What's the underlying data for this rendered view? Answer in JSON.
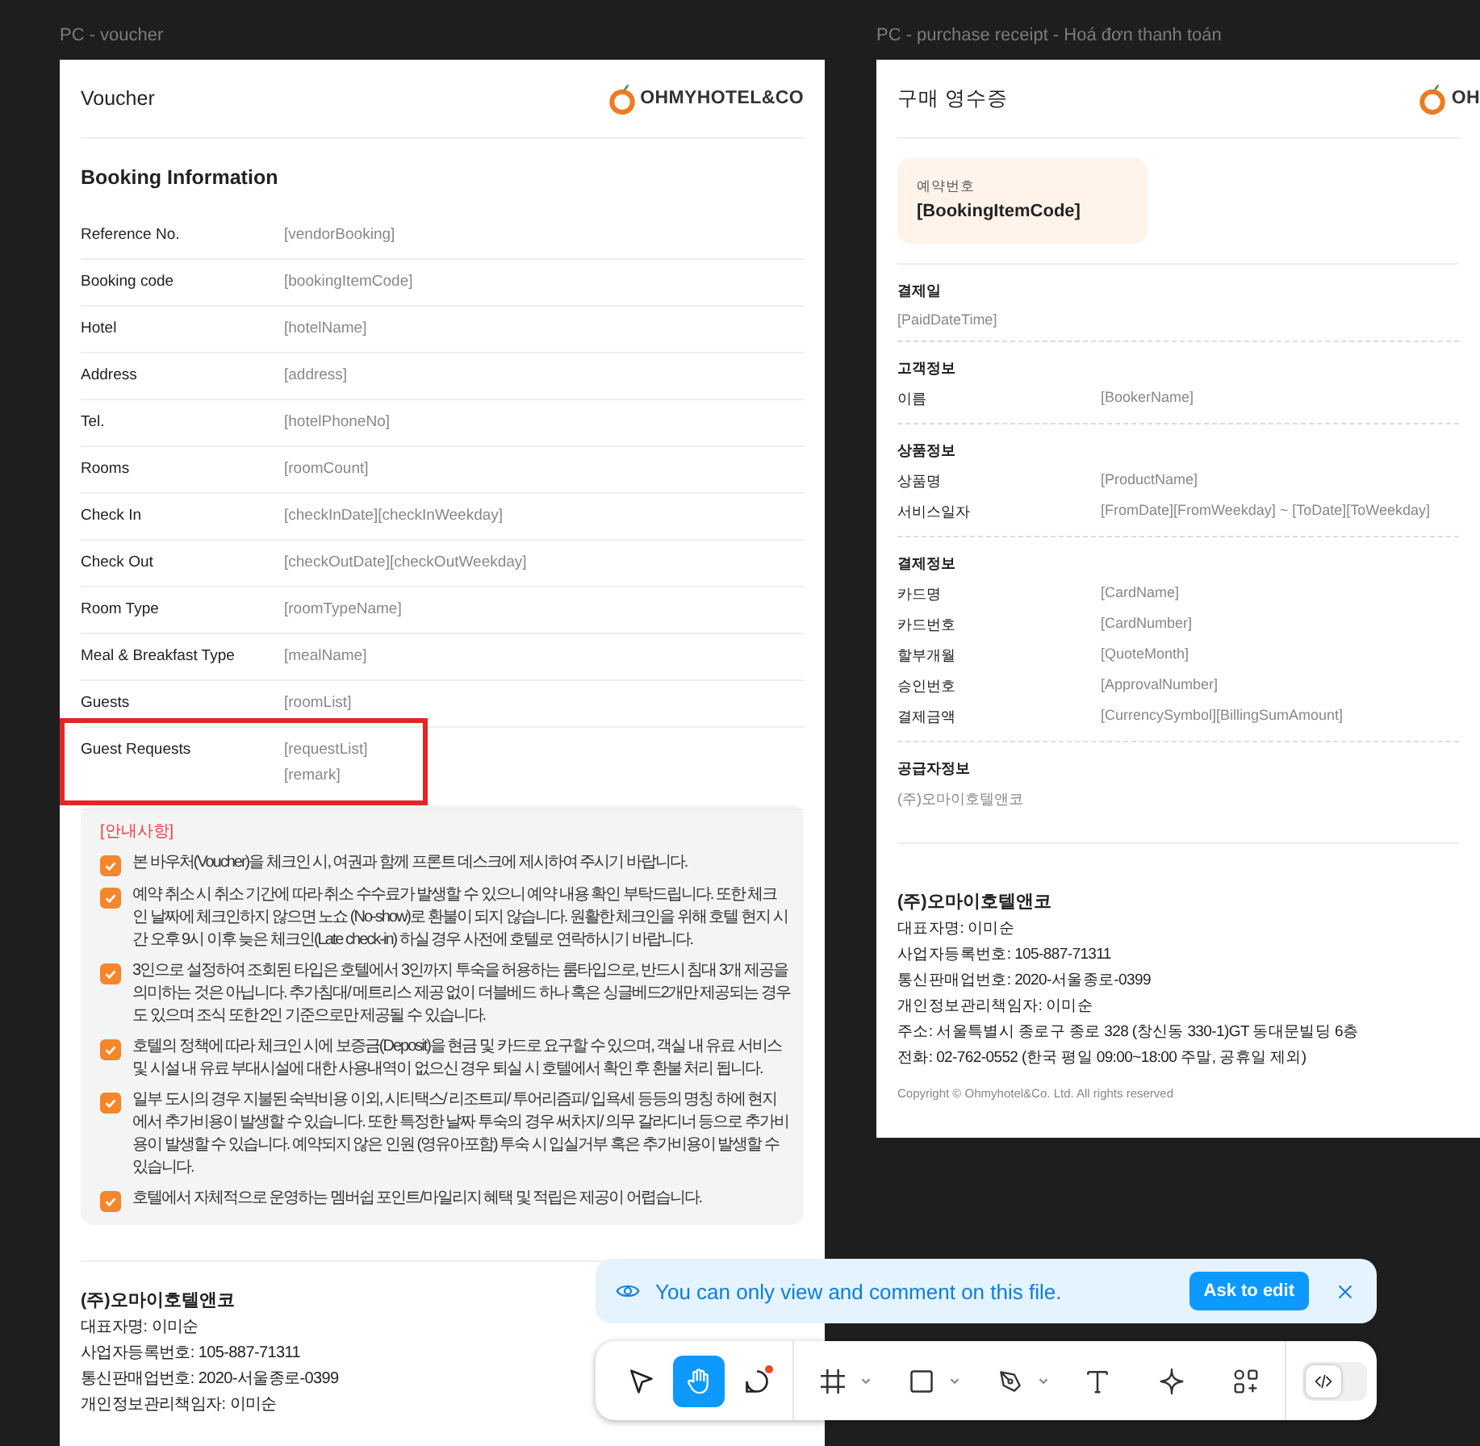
{
  "voucher": {
    "frame_label": "PC - voucher",
    "title": "Voucher",
    "logo": "OHMYHOTEL&CO",
    "section_title": "Booking Information",
    "rows": [
      {
        "label": "Reference No.",
        "values": [
          "[vendorBooking]"
        ],
        "highlighted": false
      },
      {
        "label": "Booking code",
        "values": [
          "[bookingItemCode]"
        ],
        "highlighted": false
      },
      {
        "label": "Hotel",
        "values": [
          "[hotelName]"
        ],
        "highlighted": false
      },
      {
        "label": "Address",
        "values": [
          "[address]"
        ],
        "highlighted": false
      },
      {
        "label": "Tel.",
        "values": [
          "[hotelPhoneNo]"
        ],
        "highlighted": false
      },
      {
        "label": "Rooms",
        "values": [
          "[roomCount]"
        ],
        "highlighted": false
      },
      {
        "label": "Check In",
        "values": [
          "[checkInDate][checkInWeekday]"
        ],
        "highlighted": false
      },
      {
        "label": "Check Out",
        "values": [
          "[checkOutDate][checkOutWeekday]"
        ],
        "highlighted": false
      },
      {
        "label": "Room Type",
        "values": [
          "[roomTypeName]"
        ],
        "highlighted": false
      },
      {
        "label": "Meal & Breakfast Type",
        "values": [
          "[mealName]"
        ],
        "highlighted": false
      },
      {
        "label": "Guests",
        "values": [
          "[roomList]"
        ],
        "highlighted": false
      },
      {
        "label": "Guest Requests",
        "values": [
          "[requestList]",
          "[remark]"
        ],
        "highlighted": true
      }
    ],
    "notes_title": "[안내사항]",
    "notes": [
      {
        "text": "본 바우처(Voucher)을 체크인 시, 여권과 함께 프론트 데스크에 제시하여 주시기 바랍니다.",
        "checked": true
      },
      {
        "text": "예약 취소 시 취소 기간에 따라 취소 수수료가 발생할 수 있으니 예약 내용 확인 부탁드립니다. 또한 체크인 날짜에 체크인하지 않으면 노쇼 (No-show)로 환불이 되지 않습니다. 원활한 체크인을 위해 호텔 현지 시간 오후 9시 이후 늦은 체크인(Late check-in) 하실 경우 사전에 호텔로 연락하시기 바랍니다.",
        "checked": true
      },
      {
        "text": "3인으로 설정하여 조회된 타입은 호텔에서 3인까지 투숙을 허용하는 룸타입으로, 반드시 침대 3개 제공을 의미하는 것은 아닙니다. 추가침대/ 메트리스 제공 없이 더블베드 하나 혹은 싱글베드2개만 제공되는 경우도 있으며 조식 또한 2인 기준으로만 제공될 수 있습니다.",
        "checked": true
      },
      {
        "text": "호텔의 정책에 따라 체크인 시에 보증금(Deposit)을 현금 및 카드로 요구할 수 있으며, 객실 내 유료 서비스 및 시설 내 유료 부대시설에 대한 사용내역이 없으신 경우 퇴실 시 호텔에서 확인 후 환불 처리 됩니다.",
        "checked": true
      },
      {
        "text": "일부 도시의 경우 지불된 숙박비용 이외, 시티택스/ 리조트피/ 투어리즘피/ 입욕세 등등의 명칭 하에 현지에서 추가비용이 발생할 수 있습니다. 또한 특정한 날짜 투숙의 경우 써차지/ 의무 갈라디너 등으로 추가비용이 발생할 수 있습니다. 예약되지 않은 인원 (영유아포함) 투숙 시 입실거부 혹은 추가비용이 발생할 수 있습니다.",
        "checked": true
      },
      {
        "text": "호텔에서 자체적으로 운영하는 멤버쉽 포인트/마일리지 혜택 및 적립은 제공이 어렵습니다.",
        "checked": true
      }
    ],
    "company_name": "(주)오마이호텔앤코",
    "company_lines": [
      "대표자명: 이미순",
      "사업자등록번호: 105-887-71311",
      "통신판매업번호: 2020-서울종로-0399",
      "개인정보관리책임자: 이미순"
    ]
  },
  "receipt": {
    "frame_label": "PC - purchase receipt - Hoá đơn thanh toán",
    "title": "구매 영수증",
    "logo": "OH",
    "booking_label": "예약번호",
    "booking_code": "[BookingItemCode]",
    "sections": [
      {
        "title": "결제일",
        "value": "[PaidDateTime]"
      },
      {
        "title": "고객정보",
        "rows": [
          {
            "label": "이름",
            "value": "[BookerName]"
          }
        ]
      },
      {
        "title": "상품정보",
        "rows": [
          {
            "label": "상품명",
            "value": "[ProductName]"
          },
          {
            "label": "서비스일자",
            "value": "[FromDate][FromWeekday] ~ [ToDate][ToWeekday]"
          }
        ]
      },
      {
        "title": "결제정보",
        "rows": [
          {
            "label": "카드명",
            "value": "[CardName]"
          },
          {
            "label": "카드번호",
            "value": "[CardNumber]"
          },
          {
            "label": "할부개월",
            "value": "[QuoteMonth]"
          },
          {
            "label": "승인번호",
            "value": "[ApprovalNumber]"
          },
          {
            "label": "결제금액",
            "value": "[CurrencySymbol][BillingSumAmount]"
          }
        ]
      },
      {
        "title": "공급자정보",
        "value": "(주)오마이호텔앤코"
      }
    ],
    "company_name": "(주)오마이호텔앤코",
    "company_lines": [
      "대표자명: 이미순",
      "사업자등록번호: 105-887-71311",
      "통신판매업번호: 2020-서울종로-0399",
      "개인정보관리책임자: 이미순",
      "주소: 서울특별시 종로구 종로 328 (창신동 330-1)GT 동대문빌딩 6층",
      "전화: 02-762-0552 (한국 평일 09:00~18:00 주말, 공휴일 제외)"
    ],
    "copyright": "Copyright © Ohmyhotel&Co. Ltd. All rights reserved"
  },
  "notice": {
    "text": "You can only view and comment on this file.",
    "button": "Ask to edit"
  },
  "toolbar": {
    "tools": [
      {
        "kind": "move",
        "selected": false,
        "menu": false
      },
      {
        "kind": "hand",
        "selected": true,
        "menu": false
      },
      {
        "kind": "comment",
        "selected": false,
        "menu": false,
        "unread": true
      },
      {
        "kind": "frame",
        "selected": false,
        "menu": true
      },
      {
        "kind": "shape",
        "selected": false,
        "menu": true
      },
      {
        "kind": "pen",
        "selected": false,
        "menu": true
      },
      {
        "kind": "text",
        "selected": false,
        "menu": false
      },
      {
        "kind": "actions",
        "selected": false,
        "menu": false
      },
      {
        "kind": "assets",
        "selected": false,
        "menu": false
      }
    ],
    "dev_mode": {
      "on": false
    }
  }
}
